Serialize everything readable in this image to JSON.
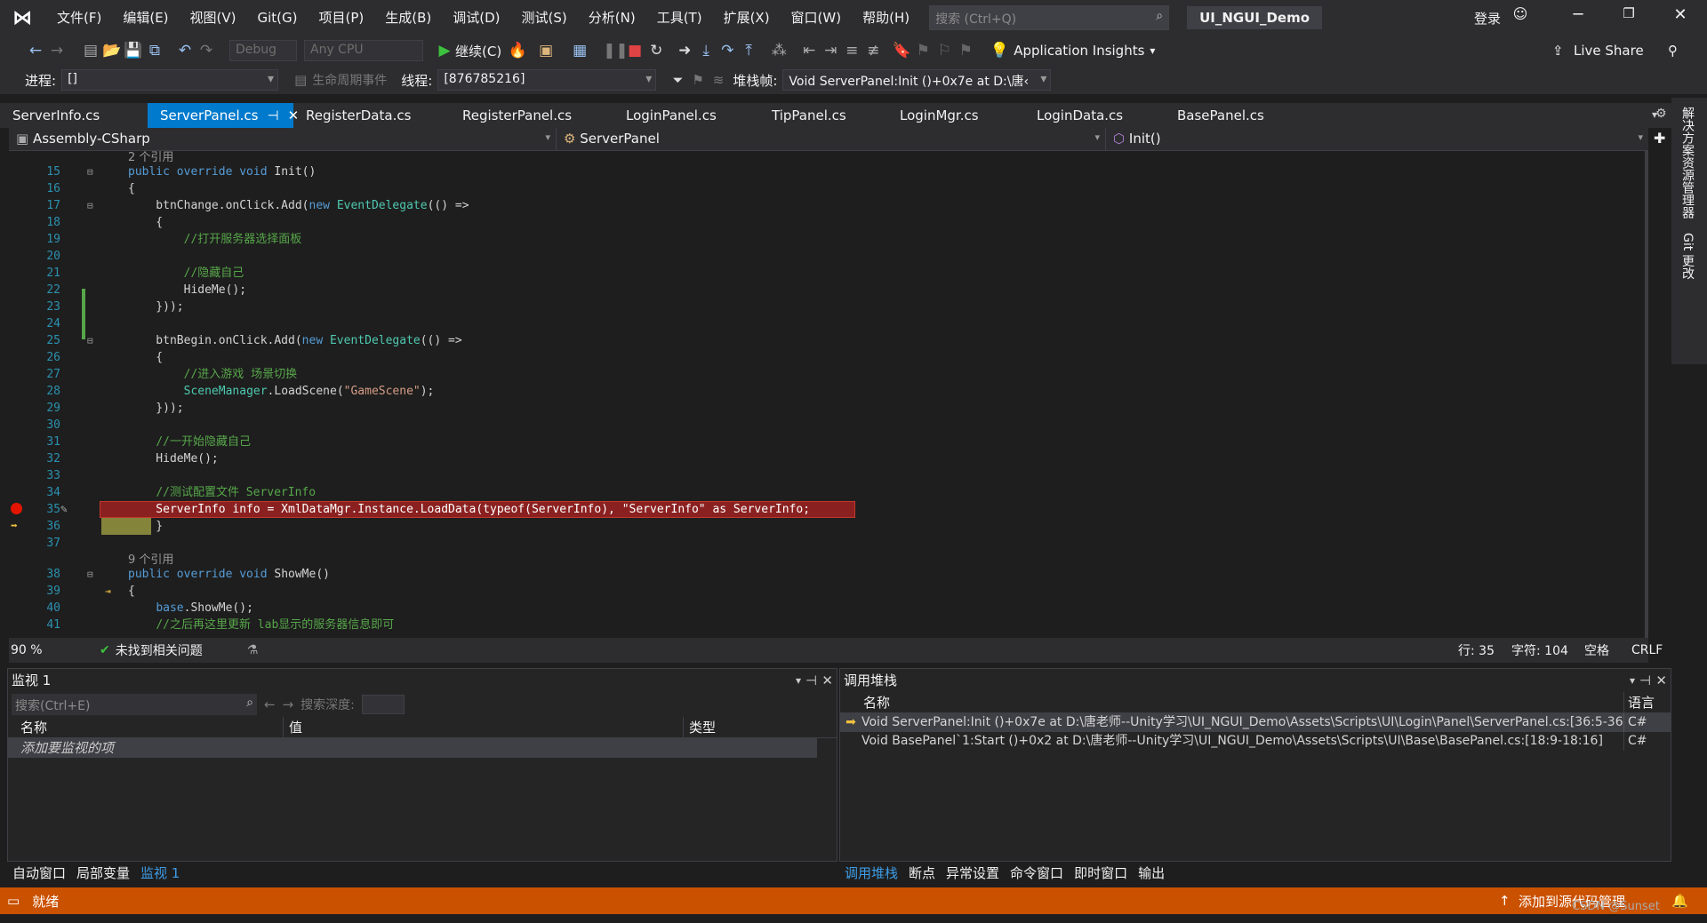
{
  "menu": [
    "文件(F)",
    "编辑(E)",
    "视图(V)",
    "Git(G)",
    "项目(P)",
    "生成(B)",
    "调试(D)",
    "测试(S)",
    "分析(N)",
    "工具(T)",
    "扩展(X)",
    "窗口(W)",
    "帮助(H)"
  ],
  "search": {
    "placeholder": "搜索 (Ctrl+Q)"
  },
  "project_name": "UI_NGUI_Demo",
  "signin": "登录",
  "toolbar1": {
    "config": "Debug",
    "platform": "Any CPU",
    "continue": "继续(C)",
    "app_insights": "Application Insights",
    "live_share": "Live Share"
  },
  "toolbar2": {
    "process_label": "进程:",
    "process_value": "[]",
    "lifecycle": "生命周期事件",
    "thread_label": "线程:",
    "thread_value": "[876785216]",
    "stack_label": "堆栈帧:",
    "stack_value": "Void ServerPanel:Init ()+0x7e at D:\\唐‹"
  },
  "tabs": [
    "ServerInfo.cs",
    "ServerPanel.cs",
    "RegisterData.cs",
    "RegisterPanel.cs",
    "LoginPanel.cs",
    "TipPanel.cs",
    "LoginMgr.cs",
    "LoginData.cs",
    "BasePanel.cs"
  ],
  "nav": {
    "assembly": "Assembly-CSharp",
    "class": "ServerPanel",
    "member": "Init()"
  },
  "refs": {
    "r1": "2 个引用",
    "r2": "9 个引用"
  },
  "code": {
    "l15": "15",
    "l16": "16",
    "l17": "17",
    "l18": "18",
    "l19": "19",
    "l20": "20",
    "l21": "21",
    "l22": "22",
    "l23": "23",
    "l24": "24",
    "l25": "25",
    "l26": "26",
    "l27": "27",
    "l28": "28",
    "l29": "29",
    "l30": "30",
    "l31": "31",
    "l32": "32",
    "l33": "33",
    "l34": "34",
    "l35": "35",
    "l36": "36",
    "l37": "37",
    "l38": "38",
    "l39": "39",
    "l40": "40",
    "l41": "41",
    "c19": "//打开服务器选择面板",
    "c21": "//隐藏自己",
    "c27": "//进入游戏 场景切换",
    "c31": "//一开始隐藏自己",
    "c34": "//测试配置文件 ServerInfo",
    "c41": "//之后再这里更新 lab显示的服务器信息即可",
    "gamescene": "\"GameScene\"",
    "serverinfo_str": "\"ServerInfo\""
  },
  "status": {
    "zoom": "90 %",
    "issues": "未找到相关问题",
    "row": "行: 35",
    "col": "字符: 104",
    "space": "空格",
    "eol": "CRLF"
  },
  "watch": {
    "title": "监视 1",
    "search": "搜索(Ctrl+E)",
    "depth": "搜索深度:",
    "col_name": "名称",
    "col_value": "值",
    "col_type": "类型",
    "add": "添加要监视的项"
  },
  "watch_tabs": [
    "自动窗口",
    "局部变量",
    "监视 1"
  ],
  "callstack": {
    "title": "调用堆栈",
    "col_name": "名称",
    "col_lang": "语言",
    "rows": [
      {
        "name": "Void ServerPanel:Init ()+0x7e at D:\\唐老师--Unity学习\\UI_NGUI_Demo\\Assets\\Scripts\\UI\\Login\\Panel\\ServerPanel.cs:[36:5-36:6]",
        "lang": "C#"
      },
      {
        "name": "Void BasePanel`1:Start ()+0x2 at D:\\唐老师--Unity学习\\UI_NGUI_Demo\\Assets\\Scripts\\UI\\Base\\BasePanel.cs:[18:9-18:16]",
        "lang": "C#"
      }
    ]
  },
  "callstack_tabs": [
    "调用堆栈",
    "断点",
    "异常设置",
    "命令窗口",
    "即时窗口",
    "输出"
  ],
  "statusbar": {
    "ready": "就绪",
    "source_control": "添加到源代码管理",
    "watermark": "CSDN @Sunset"
  },
  "right_panel": [
    "解决方案资源管理器",
    "Git 更改"
  ]
}
